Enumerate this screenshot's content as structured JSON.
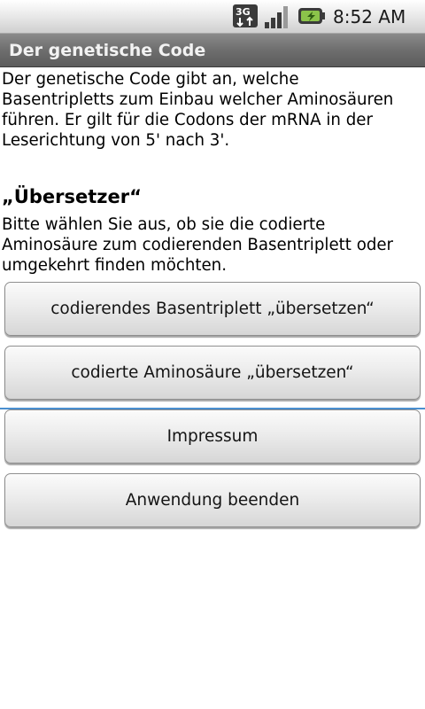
{
  "status_bar": {
    "network_label": "3G",
    "time": "8:52 AM",
    "icons": [
      "3g-icon",
      "signal-strength-icon",
      "battery-charging-icon"
    ]
  },
  "title_bar": {
    "title": "Der genetische Code"
  },
  "content": {
    "intro_lines": [
      "Der genetische Code gibt an, welche",
      "Basentripletts zum Einbau welcher Aminosäuren",
      "führen. Er gilt für die Codons der mRNA in der",
      "Leserichtung von 5' nach 3'."
    ],
    "section_heading": "„Übersetzer“",
    "instruction_lines": [
      "Bitte wählen Sie aus, ob sie die codierte",
      "Aminosäure zum codierenden Basentriplett oder",
      "umgekehrt finden möchten."
    ]
  },
  "buttons": {
    "translate_triplet": "codierendes Basentriplett „übersetzen“",
    "translate_amino_acid": "codierte Aminosäure „übersetzen“",
    "imprint": "Impressum",
    "exit_app": "Anwendung beenden"
  },
  "colors": {
    "title_bar": "#6e6e6e",
    "divider_accent": "#4a8fd0",
    "battery_accent": "#8bc34a"
  }
}
